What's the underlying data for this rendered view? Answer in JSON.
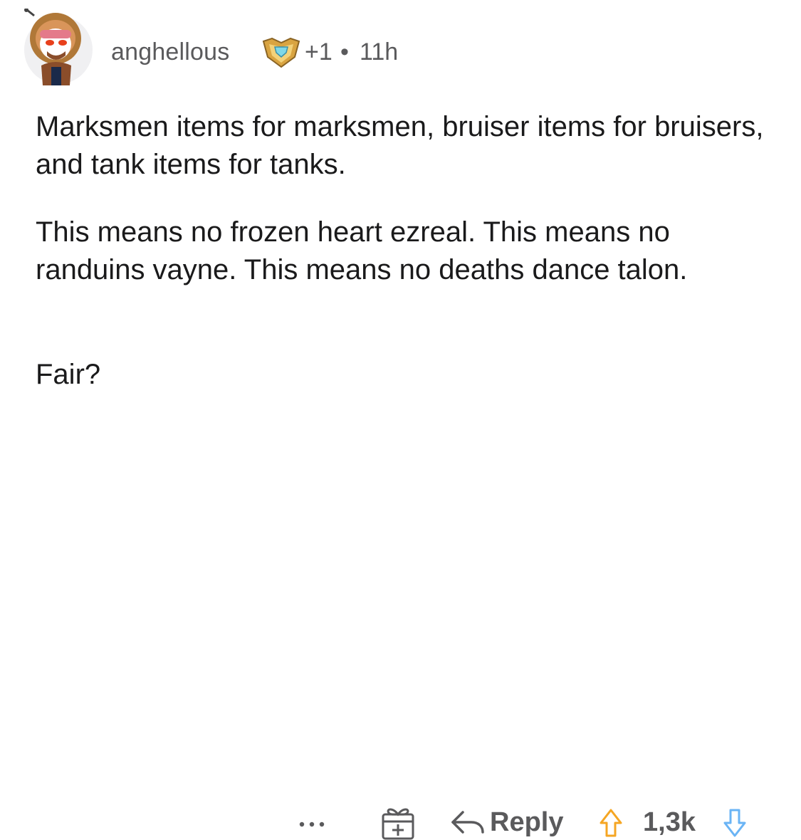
{
  "comment": {
    "author": "anghellous",
    "award_icon": "gold-award-badge-icon",
    "award_count": "+1",
    "separator": "•",
    "age": "11h",
    "paragraphs": [
      "Marksmen items for marksmen, bruiser items for bruisers, and tank items for tanks.",
      "This means no frozen heart ezreal. This means no randuins vayne. This means no deaths dance talon.",
      "Fair?"
    ]
  },
  "actions": {
    "more_icon": "more-options-icon",
    "gift_icon": "gift-award-icon",
    "reply_icon": "reply-arrow-icon",
    "reply_label": "Reply",
    "score": "1,3k",
    "upvote_icon": "upvote-arrow-icon",
    "downvote_icon": "downvote-arrow-icon",
    "upvote_color": "#f5a623",
    "downvote_color": "#6ab4f5"
  }
}
